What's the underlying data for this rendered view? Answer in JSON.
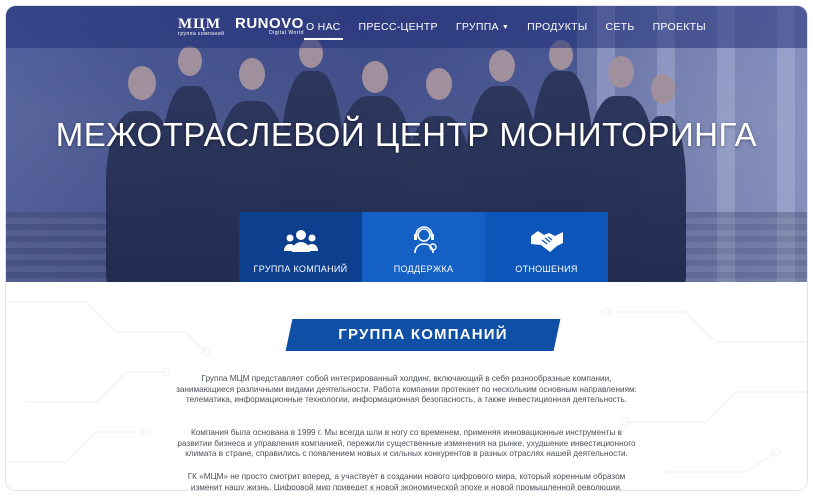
{
  "header": {
    "logo_primary": "МЦМ",
    "logo_primary_sub": "группа компаний",
    "logo_secondary": "RUNOVO",
    "logo_secondary_sub": "Digital World"
  },
  "nav": {
    "items": [
      {
        "label": "О НАС",
        "active": true
      },
      {
        "label": "ПРЕСС-ЦЕНТР"
      },
      {
        "label": "ГРУППА",
        "dropdown": true
      },
      {
        "label": "ПРОДУКТЫ"
      },
      {
        "label": "СЕТЬ"
      },
      {
        "label": "ПРОЕКТЫ"
      }
    ]
  },
  "hero": {
    "title": "МЕЖОТРАСЛЕВОЙ ЦЕНТР МОНИТОРИНГА",
    "tiles": [
      {
        "label": "ГРУППА КОМПАНИЙ",
        "icon": "group-icon"
      },
      {
        "label": "ПОДДЕРЖКА",
        "icon": "support-icon"
      },
      {
        "label": "ОТНОШЕНИЯ",
        "icon": "handshake-icon"
      }
    ]
  },
  "section": {
    "title": "ГРУППА КОМПАНИЙ",
    "paragraphs": [
      "Группа МЦМ представляет собой интегрированный холдинг, включающий в себя разнообразные компании, занимающиеся различными видами деятельности. Работа компании протекает по нескольким основным направлениям: телематика, информационные технологии, информационная безопасность, а также инвестиционная деятельность.",
      "Компания была основана в 1999 г. Мы всегда шли в ногу со временем, применяя инновационные инструменты в развитии бизнеса и управления компанией, пережили существенные изменения на рынке, ухудшение инвестиционного климата в стране, справились с появлением новых и сильных конкурентов в разных отраслях нашей деятельности.",
      "ГК «МЦМ» не просто смотрит вперед, а участвует в создании нового цифрового мира, который коренным образом изменит нашу жизнь. Цифровой мир приведет к новой экономической эпохе и новой промышленной революции."
    ]
  },
  "colors": {
    "accent": "#0f4fa6",
    "tile_dark": "#0d3f8f",
    "tile_light": "#1560c4",
    "text": "#4a4f57"
  }
}
